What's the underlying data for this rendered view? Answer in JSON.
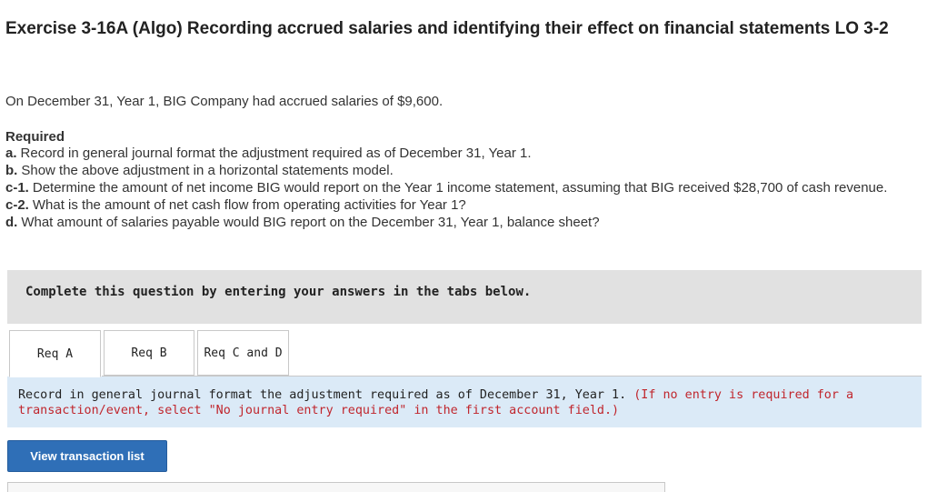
{
  "exercise": {
    "title": "Exercise 3-16A (Algo) Recording accrued salaries and identifying their effect on financial statements LO 3-2",
    "intro": "On December 31, Year 1, BIG Company had accrued salaries of $9,600."
  },
  "required": {
    "heading": "Required",
    "items": [
      {
        "label": "a.",
        "text": "Record in general journal format the adjustment required as of December 31, Year 1."
      },
      {
        "label": "b.",
        "text": "Show the above adjustment in a horizontal statements model."
      },
      {
        "label": "c-1.",
        "text": "Determine the amount of net income BIG would report on the Year 1 income statement, assuming that BIG received $28,700 of cash revenue."
      },
      {
        "label": "c-2.",
        "text": "What is the amount of net cash flow from operating activities for Year 1?"
      },
      {
        "label": "d.",
        "text": "What amount of salaries payable would BIG report on the December 31, Year 1, balance sheet?"
      }
    ]
  },
  "complete_box": {
    "text": "Complete this question by entering your answers in the tabs below."
  },
  "tabs": [
    {
      "label": "Req A",
      "active": true
    },
    {
      "label": "Req B",
      "active": false
    },
    {
      "label": "Req C and D",
      "active": false
    }
  ],
  "instructions": {
    "main": "Record in general journal format the adjustment required as of December 31, Year 1.",
    "note": "(If no entry is required for a transaction/event, select \"No journal entry required\" in the first account field.)"
  },
  "buttons": {
    "view_transaction_list": "View transaction list"
  },
  "colors": {
    "button_blue": "#2f6fb7",
    "instructions_bg": "#dbeaf7",
    "note_red": "#c0262d",
    "complete_box_bg": "#e1e1e1"
  }
}
